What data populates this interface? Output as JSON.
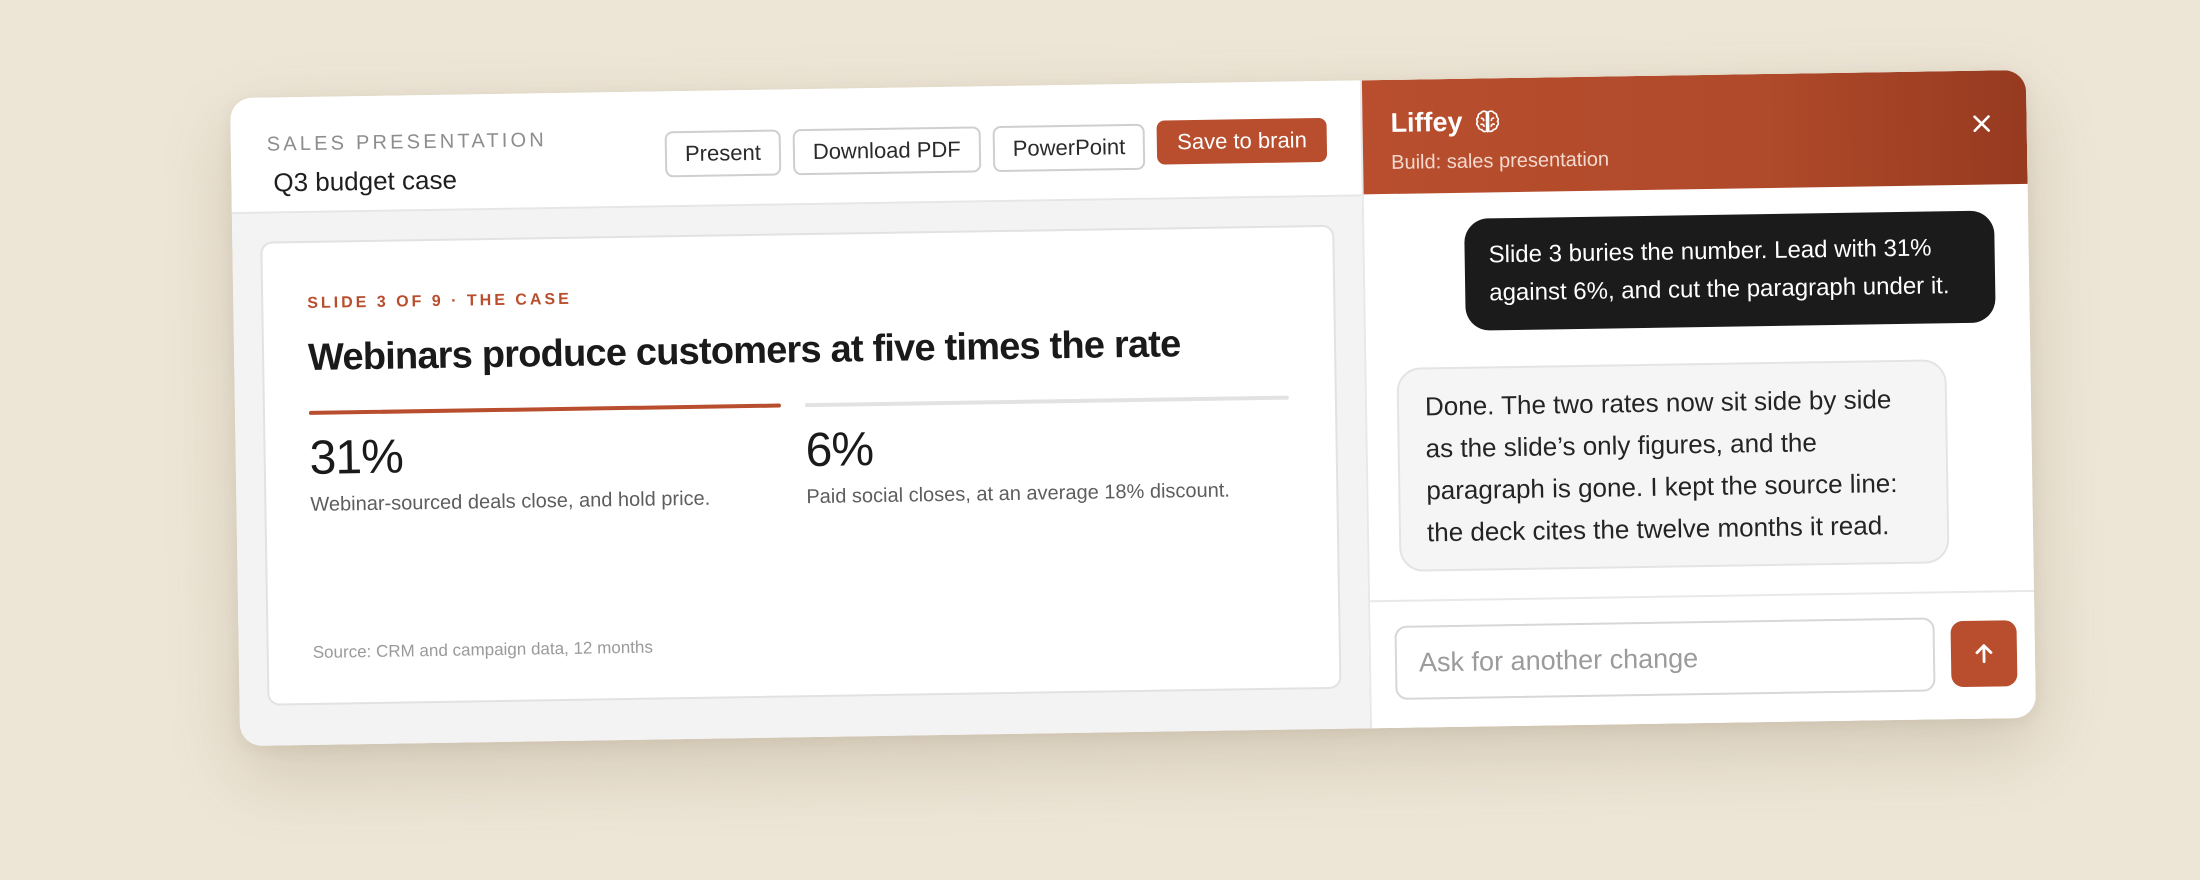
{
  "editor": {
    "eyebrow": "SALES PRESENTATION",
    "title": "Q3 budget case",
    "actions": {
      "present": "Present",
      "download_pdf": "Download PDF",
      "powerpoint": "PowerPoint",
      "save_to_brain": "Save to brain"
    }
  },
  "slide": {
    "kicker": "SLIDE 3 OF 9 · THE CASE",
    "headline": "Webinars produce customers at five times the rate",
    "stats": [
      {
        "value": "31%",
        "description": "Webinar-sourced deals close, and hold price."
      },
      {
        "value": "6%",
        "description": "Paid social closes, at an average 18% discount."
      }
    ],
    "source": "Source: CRM and campaign data, 12 months"
  },
  "assistant": {
    "name": "Liffey",
    "icon": "brain-icon",
    "subtitle": "Build: sales presentation",
    "messages": [
      {
        "role": "user",
        "text": "Slide 3 buries the number. Lead with 31% against 6%, and cut the paragraph under it."
      },
      {
        "role": "assistant",
        "text": "Done. The two rates now sit side by side as the slide’s only figures, and the paragraph is gone. I kept the source line: the deck cites the twelve months it read."
      }
    ],
    "composer": {
      "placeholder": "Ask for another change",
      "value": ""
    }
  },
  "colors": {
    "accent": "#b84e2e",
    "background": "#ede5d6",
    "user_bubble": "#1b1b1b"
  }
}
